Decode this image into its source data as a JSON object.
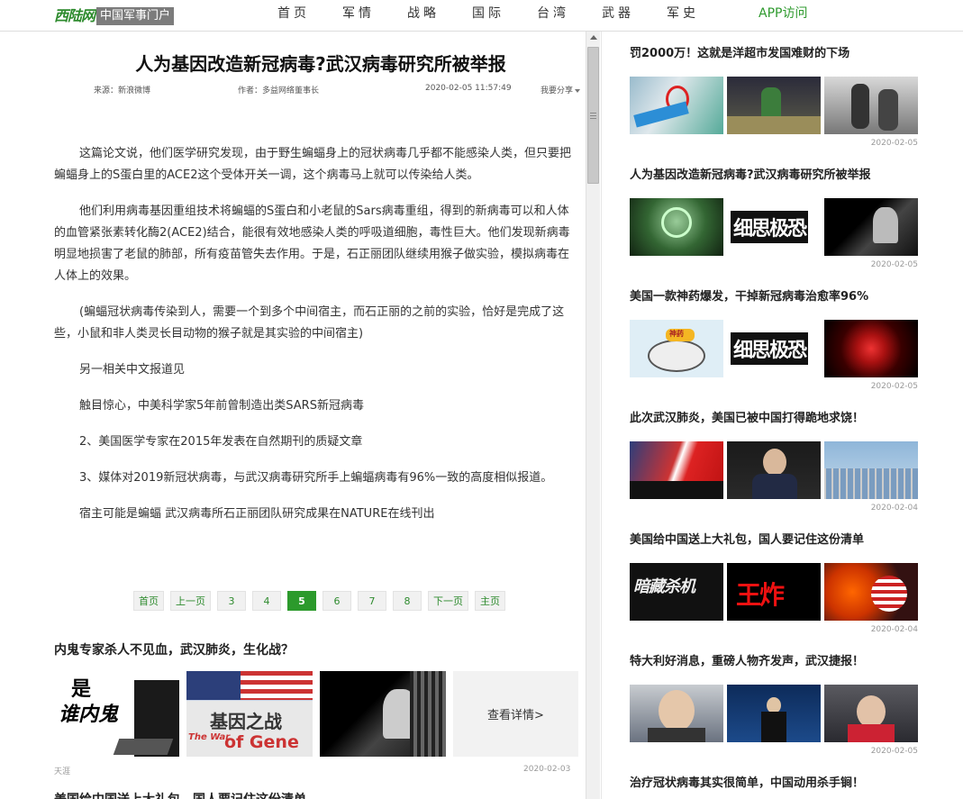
{
  "nav": {
    "logo_main": "西陆网",
    "logo_sub": "中国军事门户",
    "items": [
      "首页",
      "军情",
      "战略",
      "国际",
      "台湾",
      "武器",
      "军史"
    ],
    "app": "APP访问"
  },
  "article": {
    "title": "人为基因改造新冠病毒?武汉病毒研究所被举报",
    "source": "来源：新浪微博",
    "author": "作者：多益网络董事长",
    "time": "2020-02-05  11:57:49",
    "share": "我要分享",
    "paragraphs": [
      "这篇论文说，他们医学研究发现，由于野生蝙蝠身上的冠状病毒几乎都不能感染人类，但只要把蝙蝠身上的S蛋白里的ACE2这个受体开关一调，这个病毒马上就可以传染给人类。",
      "他们利用病毒基因重组技术将蝙蝠的S蛋白和小老鼠的Sars病毒重组，得到的新病毒可以和人体的血管紧张素转化酶2(ACE2)结合，能很有效地感染人类的呼吸道细胞，毒性巨大。他们发现新病毒明显地损害了老鼠的肺部，所有疫苗管失去作用。于是，石正丽团队继续用猴子做实验，模拟病毒在人体上的效果。",
      "(蝙蝠冠状病毒传染到人，需要一个到多个中间宿主，而石正丽的之前的实验，恰好是完成了这些，小鼠和非人类灵长目动物的猴子就是其实验的中间宿主)",
      "另一相关中文报道见",
      "触目惊心，中美科学家5年前曾制造出类SARS新冠病毒",
      "2、美国医学专家在2015年发表在自然期刊的质疑文章",
      "3、媒体对2019新冠状病毒，与武汉病毒研究所手上蝙蝠病毒有96%一致的高度相似报道。",
      "宿主可能是蝙蝠 武汉病毒所石正丽团队研究成果在NATURE在线刊出"
    ]
  },
  "pager": {
    "items": [
      "首页",
      "上一页",
      "3",
      "4",
      "5",
      "6",
      "7",
      "8",
      "下一页",
      "主页"
    ],
    "active": "5"
  },
  "related": {
    "title": "内鬼专家杀人不见血，武汉肺炎，生化战？",
    "img1_text_a": "是",
    "img1_text_b": "谁内鬼",
    "img2_text_a": "基因之战",
    "img2_text_b": "The War",
    "img2_text_c": "of Gene",
    "more": "查看详情>",
    "source": "天涯",
    "date": "2020-02-03",
    "title2": "美国给中国送上大礼包，国人要记住这份清单"
  },
  "sidebar": [
    {
      "title": "罚2000万！这就是洋超市发国难财的下场",
      "date": "2020-02-05"
    },
    {
      "title": "人为基因改造新冠病毒?武汉病毒研究所被举报",
      "date": "2020-02-05",
      "img_text": "细思极恐"
    },
    {
      "title": "美国一款神药爆发，干掉新冠病毒治愈率96%",
      "date": "2020-02-05",
      "img_text": "细思极恐",
      "img_text2": "神药"
    },
    {
      "title": "此次武汉肺炎，美国已被中国打得跪地求饶！",
      "date": "2020-02-04"
    },
    {
      "title": "美国给中国送上大礼包，国人要记住这份清单",
      "date": "2020-02-04",
      "img_text": "暗藏杀机",
      "img_text2": "王炸"
    },
    {
      "title": "特大利好消息，重磅人物齐发声，武汉捷报！",
      "date": "2020-02-05"
    },
    {
      "title": "治疗冠状病毒其实很简单，中国动用杀手锏！",
      "date": ""
    }
  ]
}
